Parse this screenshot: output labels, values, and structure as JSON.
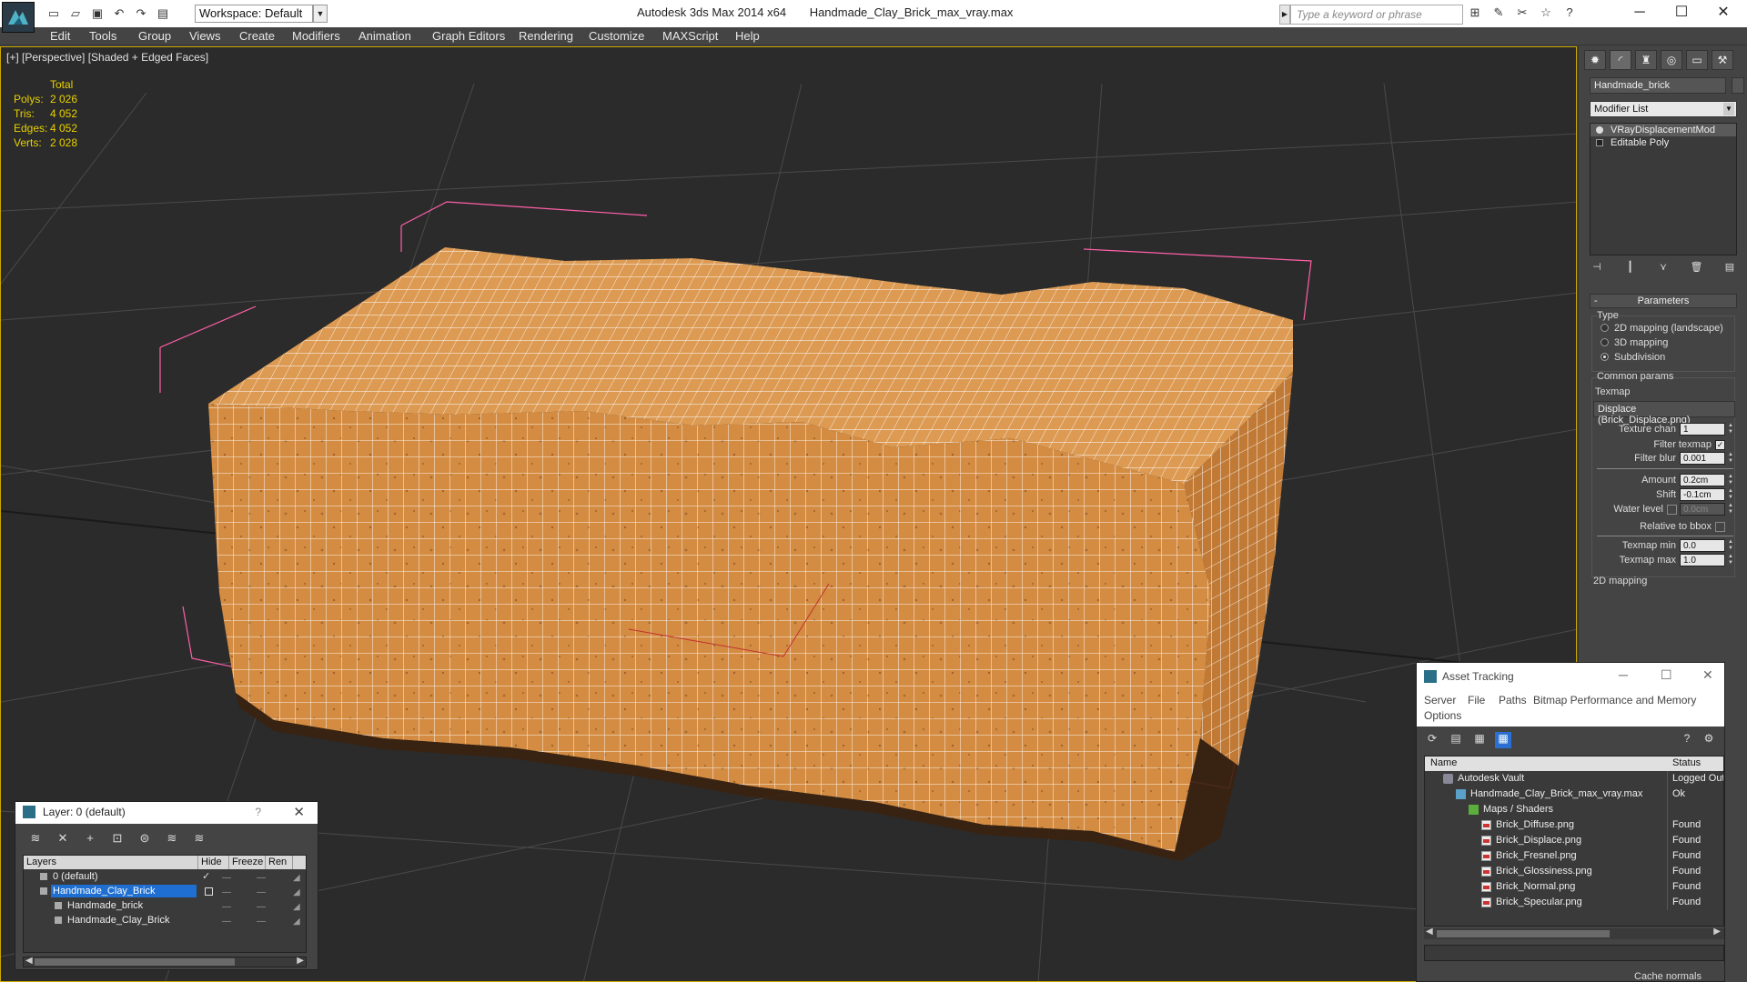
{
  "title_bar": {
    "app_title": "Autodesk 3ds Max 2014 x64",
    "file_name": "Handmade_Clay_Brick_max_vray.max",
    "workspace": "Workspace: Default",
    "search_placeholder": "Type a keyword or phrase",
    "quick_access_icons": [
      "new-icon",
      "open-icon",
      "save-icon",
      "undo-icon",
      "redo-icon",
      "project-icon"
    ],
    "help_icons": [
      "binoculars-icon",
      "communication-icon",
      "subscription-icon",
      "favorites-icon",
      "help-icon"
    ],
    "controls": {
      "minimize": "─",
      "maximize": "☐",
      "close": "✕"
    }
  },
  "menu": [
    "Edit",
    "Tools",
    "Group",
    "Views",
    "Create",
    "Modifiers",
    "Animation",
    "Graph Editors",
    "Rendering",
    "Customize",
    "MAXScript",
    "Help"
  ],
  "viewport": {
    "label": "[+] [Perspective] [Shaded + Edged Faces]",
    "stats": {
      "header": "Total",
      "rows": [
        {
          "k": "Polys:",
          "v": "2 026"
        },
        {
          "k": "Tris:",
          "v": "4 052"
        },
        {
          "k": "Edges:",
          "v": "4 052"
        },
        {
          "k": "Verts:",
          "v": "2 028"
        }
      ]
    },
    "colors": {
      "background": "#2b2b2b",
      "grid": "#4a4a4a",
      "brick": "#d9924a",
      "wire": "#ffffff",
      "bbox": "#ff5fa8"
    }
  },
  "command_panel": {
    "object_name": "Handmade_brick",
    "modifier_list": "Modifier List",
    "stack": [
      {
        "label": "VRayDisplacementMod",
        "selected": true
      },
      {
        "label": "Editable Poly",
        "selected": false
      }
    ],
    "parameters": {
      "rollout": "Parameters",
      "type_label": "Type",
      "type_options": [
        "2D mapping (landscape)",
        "3D mapping",
        "Subdivision"
      ],
      "type_selected": "Subdivision",
      "common_label": "Common params",
      "texmap_label": "Texmap",
      "texmap_value": "Displace (Brick_Displace.png)",
      "texture_chan_label": "Texture chan",
      "texture_chan": "1",
      "filter_texmap_label": "Filter texmap",
      "filter_texmap": true,
      "filter_blur_label": "Filter blur",
      "filter_blur": "0.001",
      "amount_label": "Amount",
      "amount": "0.2cm",
      "shift_label": "Shift",
      "shift": "-0.1cm",
      "water_level_label": "Water level",
      "water_level": "0.0cm",
      "water_level_on": false,
      "relative_bbox_label": "Relative to bbox",
      "relative_bbox": false,
      "texmap_min_label": "Texmap min",
      "texmap_min": "0.0",
      "texmap_max_label": "Texmap max",
      "texmap_max": "1.0",
      "next_rollout": "2D mapping"
    }
  },
  "layer_dialog": {
    "title": "Layer: 0 (default)",
    "help": "?",
    "close": "✕",
    "columns": [
      "Layers",
      "Hide",
      "Freeze",
      "Ren"
    ],
    "rows": [
      {
        "name": "0 (default)",
        "level": 0,
        "selected": false,
        "current": true
      },
      {
        "name": "Handmade_Clay_Brick",
        "level": 0,
        "selected": true,
        "current": false
      },
      {
        "name": "Handmade_brick",
        "level": 1,
        "selected": false,
        "current": false
      },
      {
        "name": "Handmade_Clay_Brick",
        "level": 1,
        "selected": false,
        "current": false
      }
    ]
  },
  "asset_tracking": {
    "title": "Asset Tracking",
    "menu": [
      "Server",
      "File",
      "Paths",
      "Bitmap Performance and Memory",
      "Options"
    ],
    "columns": [
      "Name",
      "Status"
    ],
    "rows": [
      {
        "name": "Autodesk Vault",
        "status": "Logged Out",
        "level": 0,
        "icon": "vault"
      },
      {
        "name": "Handmade_Clay_Brick_max_vray.max",
        "status": "Ok",
        "level": 1,
        "icon": "max"
      },
      {
        "name": "Maps / Shaders",
        "status": "",
        "level": 2,
        "icon": "maps"
      },
      {
        "name": "Brick_Diffuse.png",
        "status": "Found",
        "level": 3,
        "icon": "png"
      },
      {
        "name": "Brick_Displace.png",
        "status": "Found",
        "level": 3,
        "icon": "png"
      },
      {
        "name": "Brick_Fresnel.png",
        "status": "Found",
        "level": 3,
        "icon": "png"
      },
      {
        "name": "Brick_Glossiness.png",
        "status": "Found",
        "level": 3,
        "icon": "png"
      },
      {
        "name": "Brick_Normal.png",
        "status": "Found",
        "level": 3,
        "icon": "png"
      },
      {
        "name": "Brick_Specular.png",
        "status": "Found",
        "level": 3,
        "icon": "png"
      }
    ],
    "cache_normals": "Cache normals"
  }
}
